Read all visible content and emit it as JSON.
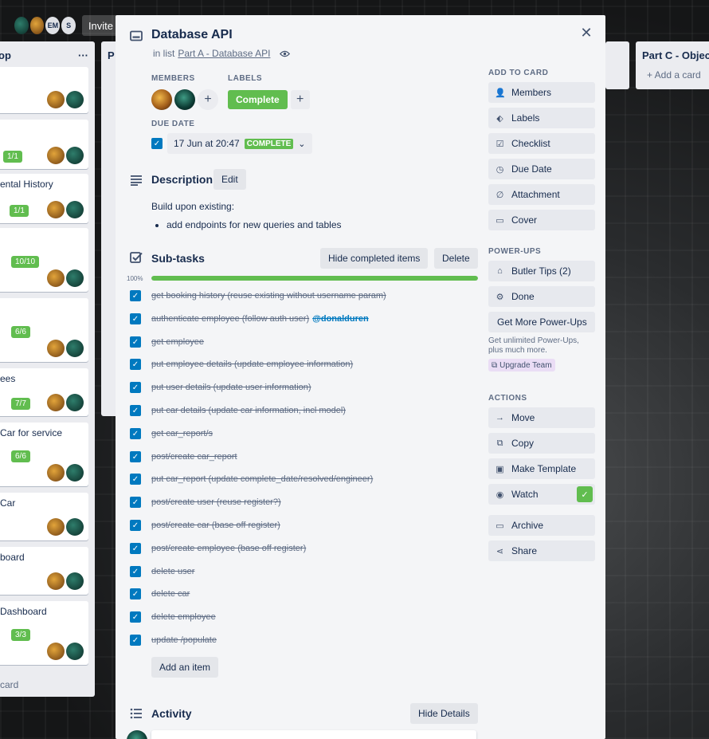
{
  "card": {
    "title": "Database API",
    "in_list_prefix": "in list",
    "list_name": "Part A - Database API",
    "members_label": "MEMBERS",
    "labels_label": "LABELS",
    "label_complete": "Complete",
    "due_label": "DUE DATE",
    "due_value": "17 Jun at 20:47",
    "due_status": "COMPLETE"
  },
  "description": {
    "title": "Description",
    "edit_label": "Edit",
    "intro": "Build upon existing:",
    "bullets": [
      "add endpoints for new queries and tables"
    ]
  },
  "subtasks": {
    "title": "Sub-tasks",
    "hide_label": "Hide completed items",
    "delete_label": "Delete",
    "progress_text": "100%",
    "progress": 1.0,
    "items": [
      "get booking history (reuse existing without username param)",
      "authenticate employee (follow auth user)",
      "get employee",
      "put employee details (update employee information)",
      "put user details (update user information)",
      "put car details (update car information, incl model)",
      "get car_report/s",
      "post/create car_report",
      "put car_report (update complete_date/resolved/engineer)",
      "post/create user (reuse register?)",
      "post/create car (base off register)",
      "post/create employee (base off register)",
      "delete user",
      "delete car",
      "delete employee",
      "update /populate"
    ],
    "mention": "@donalduren",
    "add_item_label": "Add an item"
  },
  "activity": {
    "title": "Activity",
    "hide_details_label": "Hide Details"
  },
  "sidebar": {
    "add_to_card_label": "ADD TO CARD",
    "add_to_card": [
      {
        "label": "Members",
        "icon": "person-icon"
      },
      {
        "label": "Labels",
        "icon": "tag-icon"
      },
      {
        "label": "Checklist",
        "icon": "checklist-icon"
      },
      {
        "label": "Due Date",
        "icon": "clock-icon"
      },
      {
        "label": "Attachment",
        "icon": "paperclip-icon"
      },
      {
        "label": "Cover",
        "icon": "cover-icon"
      }
    ],
    "powerups_label": "POWER-UPS",
    "powerups": [
      {
        "label": "Butler Tips (2)",
        "icon": "butler-icon"
      },
      {
        "label": "Done",
        "icon": "gears-icon"
      }
    ],
    "get_more_label": "Get More Power-Ups",
    "note": "Get unlimited Power-Ups, plus much more.",
    "upgrade_label": "Upgrade Team",
    "actions_label": "ACTIONS",
    "actions": [
      {
        "label": "Move",
        "icon": "arrow-right-icon"
      },
      {
        "label": "Copy",
        "icon": "copy-icon"
      },
      {
        "label": "Make Template",
        "icon": "template-icon"
      },
      {
        "label": "Watch",
        "icon": "eye-icon"
      }
    ],
    "archive_label": "Archive",
    "share_label": "Share"
  },
  "background": {
    "invite_label": "Invite",
    "avatar_initials": [
      "EM",
      "S"
    ],
    "left_list_title_suffix": "op",
    "mid_list_title_prefix": "P",
    "right_list_title": "Part C - Object",
    "add_card_label": "+ Add a card",
    "left_cards": [
      {
        "text": "",
        "badge": ""
      },
      {
        "text": "",
        "badge": "1/1"
      },
      {
        "text": "ental History",
        "badge": "1/1"
      },
      {
        "text": "",
        "badge": "10/10"
      },
      {
        "text": "",
        "badge": "6/6"
      },
      {
        "text": "ees",
        "badge": "7/7"
      },
      {
        "text": "Car for service",
        "badge": "6/6"
      },
      {
        "text": "Car",
        "badge": ""
      },
      {
        "text": "board",
        "badge": ""
      },
      {
        "text": "Dashboard",
        "badge": "3/3"
      }
    ],
    "left_footer": "card"
  },
  "colors": {
    "accent_green": "#61bd4f",
    "check_blue": "#0079bf",
    "modal_bg": "#f4f5f7"
  }
}
